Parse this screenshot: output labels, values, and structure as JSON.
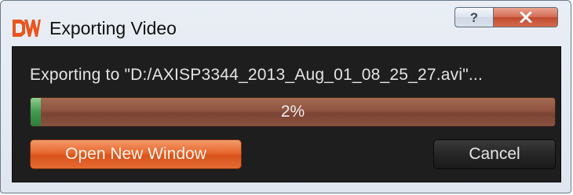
{
  "window": {
    "title": "Exporting Video",
    "help_glyph": "?",
    "close_glyph": "X"
  },
  "export": {
    "message": "Exporting to \"D:/AXISP3344_2013_Aug_01_08_25_27.avi\"...",
    "progress_label": "2%",
    "progress_value": 0.02
  },
  "buttons": {
    "open_new_window": "Open New Window",
    "cancel": "Cancel"
  },
  "colors": {
    "logo": "#e8561e",
    "progress_track": "#8e5440",
    "progress_fill": "#3f9a4f",
    "open_button": "#e7672f",
    "body_background": "#1e1e1e"
  },
  "icons": {
    "logo": "dw-logo-icon",
    "help": "help-icon",
    "close": "close-icon"
  }
}
